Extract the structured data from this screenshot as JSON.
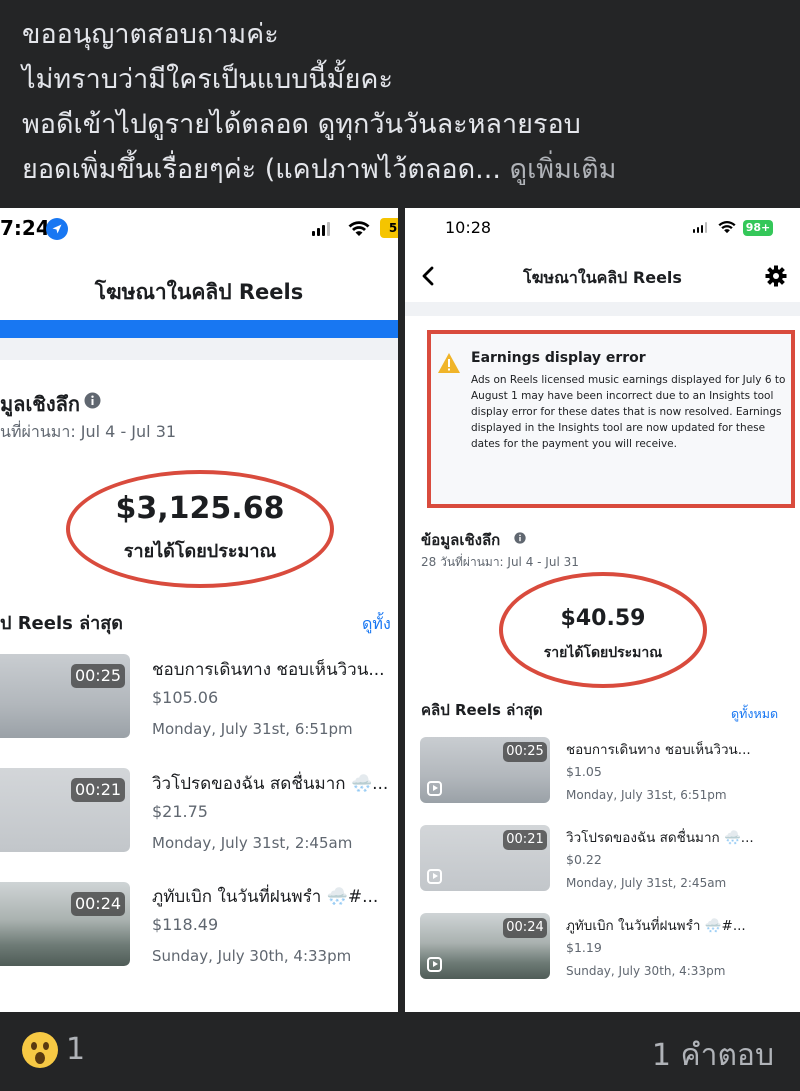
{
  "post": {
    "lines": [
      "ขออนุญาตสอบถามค่ะ",
      "ไม่ทราบว่ามีใครเป็นแบบนี้มั้ยคะ",
      "พอดีเข้าไปดูรายได้ตลอด ดูทุกวันวันละหลายรอบ",
      "ยอดเพิ่มขึ้นเรื่อยๆค่ะ (แคปภาพไว้ตลอด..."
    ],
    "see_more": "ดูเพิ่มเติม"
  },
  "left": {
    "time": "7:24",
    "battery": "5",
    "title": "โฆษณาในคลิป Reels",
    "insights_label": "มูลเชิงลึก",
    "date_range": "นที่ผ่านมา: Jul 4 - Jul 31",
    "amount": "$3,125.68",
    "amount_label": "รายได้โดยประมาณ",
    "recent_label": "ป Reels ล่าสุด",
    "see_all": "ดูทั้ง",
    "clips": [
      {
        "duration": "00:25",
        "title": "ชอบการเดินทาง ชอบเห็นวิวน...",
        "amount": "$105.06",
        "date": "Monday, July 31st, 6:51pm"
      },
      {
        "duration": "00:21",
        "title": "วิวโปรดของฉัน สดชื่นมาก 🌨️...",
        "amount": "$21.75",
        "date": "Monday, July 31st, 2:45am"
      },
      {
        "duration": "00:24",
        "title": "ภูทับเบิก ในวันที่ฝนพรำ 🌨️#...",
        "amount": "$118.49",
        "date": "Sunday, July 30th, 4:33pm"
      }
    ]
  },
  "right": {
    "time": "10:28",
    "battery": "98+",
    "title": "โฆษณาในคลิป Reels",
    "error_title": "Earnings display error",
    "error_body": "Ads on Reels licensed music earnings displayed for July 6 to August 1 may have been incorrect due to an Insights tool display error for these dates that is now resolved. Earnings displayed in the Insights tool are now updated for these dates for the payment you will receive.",
    "insights_label": "ข้อมูลเชิงลึก",
    "date_range": "28 วันที่ผ่านมา: Jul 4 - Jul 31",
    "amount": "$40.59",
    "amount_label": "รายได้โดยประมาณ",
    "recent_label": "คลิป Reels ล่าสุด",
    "see_all": "ดูทั้งหมด",
    "clips": [
      {
        "duration": "00:25",
        "title": "ชอบการเดินทาง ชอบเห็นวิวน...",
        "amount": "$1.05",
        "date": "Monday, July 31st, 6:51pm"
      },
      {
        "duration": "00:21",
        "title": "วิวโปรดของฉัน สดชื่นมาก 🌨️...",
        "amount": "$0.22",
        "date": "Monday, July 31st, 2:45am"
      },
      {
        "duration": "00:24",
        "title": "ภูทับเบิก ในวันที่ฝนพรำ 🌨️#...",
        "amount": "$1.19",
        "date": "Sunday, July 30th, 4:33pm"
      }
    ]
  },
  "footer": {
    "reaction_emoji": "wow-face-icon",
    "reaction_count": "1",
    "reply_label": "1 คำตอบ"
  },
  "colors": {
    "accent_blue": "#1877f2",
    "oval_red": "#d94b3d",
    "battery_green": "#34c759",
    "warning_yellow": "#f0b429"
  }
}
